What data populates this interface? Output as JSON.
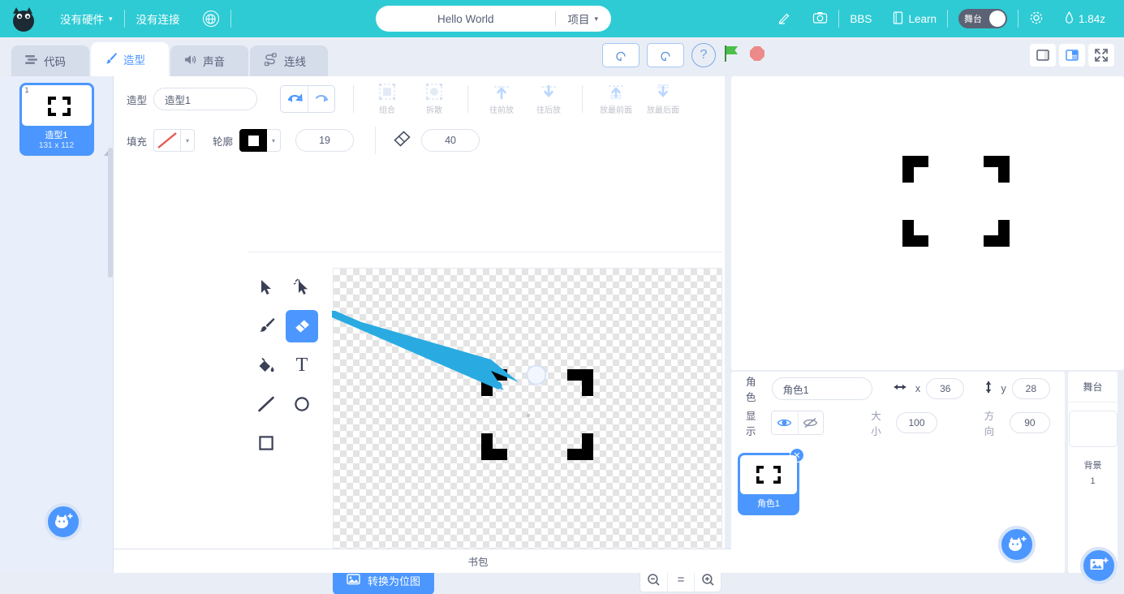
{
  "menubar": {
    "logo": "cat-logo",
    "hardware": {
      "label": "没有硬件",
      "caret": "▾"
    },
    "connection": {
      "label": "没有连接"
    },
    "language_icon": "globe-icon",
    "project": {
      "name": "Hello World",
      "menu_label": "项目",
      "caret": "▾"
    },
    "tools": [
      {
        "name": "edit-icon",
        "label": ""
      },
      {
        "name": "camera-icon",
        "label": ""
      },
      {
        "name": "bbs-link",
        "label": "BBS"
      },
      {
        "name": "learn-link",
        "label": "Learn"
      }
    ],
    "stage_toggle": {
      "label": "舞台"
    },
    "settings_icon": "gear-icon",
    "version": {
      "icon": "flask-icon",
      "label": "1.84z"
    }
  },
  "tabs": [
    {
      "label": "代码",
      "icon": "code-icon",
      "active": false
    },
    {
      "label": "造型",
      "icon": "brush-icon",
      "active": true
    },
    {
      "label": "声音",
      "icon": "speaker-icon",
      "active": false
    },
    {
      "label": "连线",
      "icon": "wiring-icon",
      "active": false
    }
  ],
  "center_controls": [
    {
      "name": "rotate-ccw-button",
      "icon": "↺"
    },
    {
      "name": "rotate-cw-button",
      "icon": "↻"
    },
    {
      "name": "help-button",
      "icon": "?"
    },
    {
      "name": "green-flag-button",
      "icon": "flag"
    },
    {
      "name": "stop-button",
      "icon": "stop"
    }
  ],
  "stage_size_controls": [
    {
      "name": "small-stage-button",
      "active": false
    },
    {
      "name": "large-stage-button",
      "active": true
    },
    {
      "name": "fullscreen-button",
      "active": false
    }
  ],
  "costume_list": {
    "items": [
      {
        "index": "1",
        "name": "造型1",
        "size": "131 x 112"
      }
    ],
    "add_button": "add-costume-button"
  },
  "paint_editor": {
    "costume_label": "造型",
    "costume_name": "造型1",
    "undo": "undo-button",
    "redo": "redo-button",
    "arrange": [
      {
        "label": "组合",
        "name": "group-button"
      },
      {
        "label": "拆散",
        "name": "ungroup-button"
      },
      {
        "label": "往前放",
        "name": "forward-button"
      },
      {
        "label": "往后放",
        "name": "backward-button"
      },
      {
        "label": "放最前面",
        "name": "front-button"
      },
      {
        "label": "放最后面",
        "name": "back-button"
      }
    ],
    "fill_label": "填充",
    "fill_value": "none",
    "outline_label": "轮廓",
    "outline_color": "#000000",
    "outline_width": "19",
    "eraser_label": "eraser-icon",
    "eraser_size": "40",
    "tools": [
      {
        "name": "select-tool",
        "glyph": "arrow",
        "active": false
      },
      {
        "name": "reshape-tool",
        "glyph": "node-arrow",
        "active": false
      },
      {
        "name": "brush-tool",
        "glyph": "brush",
        "active": false
      },
      {
        "name": "eraser-tool",
        "glyph": "eraser",
        "active": true
      },
      {
        "name": "fill-tool",
        "glyph": "bucket",
        "active": false
      },
      {
        "name": "text-tool",
        "glyph": "T",
        "active": false
      },
      {
        "name": "line-tool",
        "glyph": "line",
        "active": false
      },
      {
        "name": "circle-tool",
        "glyph": "circle",
        "active": false
      },
      {
        "name": "rect-tool",
        "glyph": "square",
        "active": false
      }
    ],
    "convert_button": "转换为位图",
    "zoom_controls": [
      {
        "name": "zoom-out-button",
        "label": "−"
      },
      {
        "name": "zoom-reset-button",
        "label": "="
      },
      {
        "name": "zoom-in-button",
        "label": "+"
      }
    ]
  },
  "sprite_panel": {
    "sprite_label": "角色",
    "sprite_name": "角色1",
    "x_label": "x",
    "x_value": "36",
    "y_label": "y",
    "y_value": "28",
    "show_label": "显示",
    "show_on_icon": "eye-icon",
    "show_off_icon": "eye-off-icon",
    "size_label": "大小",
    "size_value": "100",
    "direction_label": "方向",
    "direction_value": "90",
    "cards": [
      {
        "name": "角色1"
      }
    ],
    "add_sprite_button": "add-sprite-button"
  },
  "stage_panel": {
    "header": "舞台",
    "backdrop_label": "背景",
    "backdrop_count": "1",
    "add_backdrop_button": "add-backdrop-button"
  },
  "backpack": {
    "label": "书包"
  },
  "colors": {
    "accent": "#4c97ff",
    "brand": "#2ecbd4",
    "text": "#575e75",
    "panel": "#e9eef6"
  }
}
